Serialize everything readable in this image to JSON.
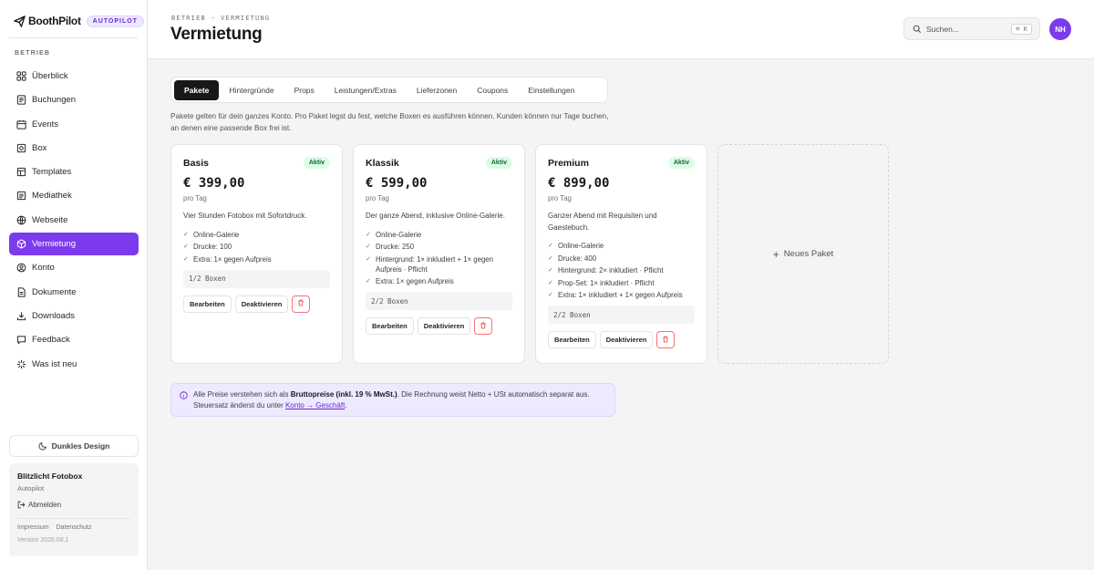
{
  "brand": {
    "name": "BoothPilot",
    "badge": "AUTOPILOT"
  },
  "sidebar": {
    "section": "BETRIEB",
    "items": [
      {
        "label": "Überblick",
        "icon": "grid-icon",
        "active": false
      },
      {
        "label": "Buchungen",
        "icon": "list-icon",
        "active": false
      },
      {
        "label": "Events",
        "icon": "calendar-icon",
        "active": false
      },
      {
        "label": "Box",
        "icon": "box-icon",
        "active": false
      },
      {
        "label": "Templates",
        "icon": "template-icon",
        "active": false
      },
      {
        "label": "Mediathek",
        "icon": "image-icon",
        "active": false
      },
      {
        "label": "Webseite",
        "icon": "globe-icon",
        "active": false
      },
      {
        "label": "Vermietung",
        "icon": "package-icon",
        "active": true
      },
      {
        "label": "Konto",
        "icon": "user-icon",
        "active": false
      },
      {
        "label": "Dokumente",
        "icon": "document-icon",
        "active": false
      },
      {
        "label": "Downloads",
        "icon": "download-icon",
        "active": false
      },
      {
        "label": "Feedback",
        "icon": "message-icon",
        "active": false
      },
      {
        "label": "Was ist neu",
        "icon": "sparkle-icon",
        "active": false
      }
    ],
    "dark_mode_label": "Dunkles Design",
    "account": {
      "name": "Blitzlicht Fotobox",
      "plan": "Autopilot",
      "logout": "Abmelden",
      "imprint": "Impressum",
      "privacy": "Datenschutz",
      "version": "Version 2026.08.1"
    }
  },
  "header": {
    "breadcrumb": "BETRIEB · VERMIETUNG",
    "title": "Vermietung",
    "search_placeholder": "Suchen...",
    "search_shortcut": "⌘ K",
    "avatar_initials": "NH"
  },
  "tabs": [
    "Pakete",
    "Hintergründe",
    "Props",
    "Leistungen/Extras",
    "Lieferzonen",
    "Coupons",
    "Einstellungen"
  ],
  "active_tab": "Pakete",
  "intro": "Pakete gelten für dein ganzes Konto. Pro Paket legst du fest, welche Boxen es ausführen können. Kunden können nur Tage buchen, an denen eine passende Box frei ist.",
  "packages": [
    {
      "name": "Basis",
      "status": "Aktiv",
      "price": "€ 399,00",
      "per": "pro Tag",
      "description": "Vier Stunden Fotobox mit Sofortdruck.",
      "features": [
        "Online-Galerie",
        "Drucke: 100",
        "Extra: 1× gegen Aufpreis"
      ],
      "boxes": "1/2 Boxen",
      "edit": "Bearbeiten",
      "deactivate": "Deaktivieren"
    },
    {
      "name": "Klassik",
      "status": "Aktiv",
      "price": "€ 599,00",
      "per": "pro Tag",
      "description": "Der ganze Abend, inklusive Online-Galerie.",
      "features": [
        "Online-Galerie",
        "Drucke: 250",
        "Hintergrund: 1× inkludiert + 1× gegen Aufpreis · Pflicht",
        "Extra: 1× gegen Aufpreis"
      ],
      "boxes": "2/2 Boxen",
      "edit": "Bearbeiten",
      "deactivate": "Deaktivieren"
    },
    {
      "name": "Premium",
      "status": "Aktiv",
      "price": "€ 899,00",
      "per": "pro Tag",
      "description": "Ganzer Abend mit Requisiten und Gaestebuch.",
      "features": [
        "Online-Galerie",
        "Drucke: 400",
        "Hintergrund: 2× inkludiert · Pflicht",
        "Prop-Set: 1× inkludiert · Pflicht",
        "Extra: 1× inkludiert + 1× gegen Aufpreis"
      ],
      "boxes": "2/2 Boxen",
      "edit": "Bearbeiten",
      "deactivate": "Deaktivieren"
    }
  ],
  "new_package_label": "Neues Paket",
  "notice": {
    "pre": "Alle Preise verstehen sich als ",
    "bold": "Bruttopreise (inkl. 19 % MwSt.)",
    "mid": ". Die Rechnung weist Netto + USt automatisch separat aus. Steuersatz änderst du unter ",
    "link": "Konto → Geschäft",
    "post": "."
  },
  "colors": {
    "accent": "#7c3aed",
    "active_badge_bg": "#dcfce7",
    "notice_bg": "#ede9fe",
    "danger": "#ef4444"
  }
}
